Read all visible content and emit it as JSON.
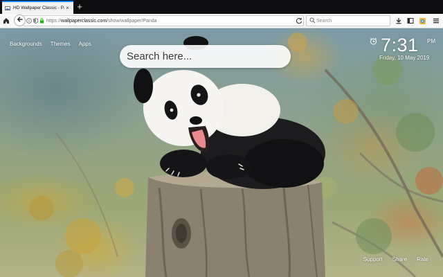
{
  "browser": {
    "tab": {
      "title": "HD Wallpaper Classic - Panda",
      "favicon": "wallpaper-favicon-icon",
      "close": "×"
    },
    "new_tab": "+",
    "url": {
      "scheme": "https://",
      "domain": "wallpaperclassic.com",
      "path": "/show/wallpaper/Panda"
    },
    "search_placeholder": "Search",
    "colors": {
      "tab_accent": "#0a84ff",
      "tabbar": "#0d0d0f",
      "toolbar": "#f9f9fa"
    },
    "icons": [
      "home-icon",
      "back-icon",
      "info-icon",
      "tracking-shield-icon",
      "lock-icon",
      "reload-icon",
      "search-icon",
      "downloads-icon",
      "library-icon",
      "extension-icon",
      "menu-icon"
    ]
  },
  "page": {
    "nav": [
      "Backgrounds",
      "Themes",
      "Apps"
    ],
    "search": {
      "placeholder": "Search here..."
    },
    "clock": {
      "time": "7:31",
      "period": "PM",
      "date": "Friday, 10 May 2019"
    },
    "footer": [
      "Support",
      "Share",
      "Rate"
    ],
    "wallpaper": {
      "subject": "panda-on-tree-stump-image"
    }
  }
}
